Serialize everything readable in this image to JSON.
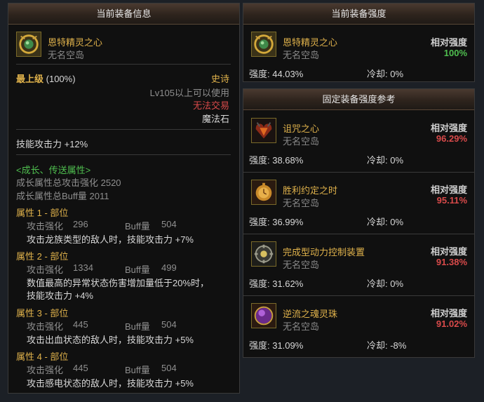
{
  "left_panel": {
    "header": "当前装备信息",
    "item": {
      "name": "恩特精灵之心",
      "source": "无名空岛",
      "icon": "green-gem-necklace-icon"
    },
    "grade_label": "最上级",
    "grade_pct": "(100%)",
    "rarity": "史诗",
    "level_req": "Lv105以上可以使用",
    "trade": "无法交易",
    "type": "魔法石",
    "main_stat": "技能攻击力 +12%",
    "growth": {
      "title": "<成长、传送属性>",
      "total_attack": "成长属性总攻击强化 2520",
      "total_buff": "成长属性总Buff量 2011",
      "attrs": [
        {
          "title": "属性 1 - 部位",
          "attack_label": "攻击强化",
          "attack_val": "296",
          "buff_label": "Buff量",
          "buff_val": "504",
          "desc1": "攻击龙族类型的敌人时，技能攻击力 +7%",
          "desc2": ""
        },
        {
          "title": "属性 2 - 部位",
          "attack_label": "攻击强化",
          "attack_val": "1334",
          "buff_label": "Buff量",
          "buff_val": "499",
          "desc1": "数值最高的异常状态伤害增加量低于20%时，",
          "desc2": "技能攻击力 +4%"
        },
        {
          "title": "属性 3 - 部位",
          "attack_label": "攻击强化",
          "attack_val": "445",
          "buff_label": "Buff量",
          "buff_val": "504",
          "desc1": "攻击出血状态的敌人时，技能攻击力 +5%",
          "desc2": ""
        },
        {
          "title": "属性 4 - 部位",
          "attack_label": "攻击强化",
          "attack_val": "445",
          "buff_label": "Buff量",
          "buff_val": "504",
          "desc1": "攻击感电状态的敌人时，技能攻击力 +5%",
          "desc2": ""
        }
      ]
    }
  },
  "current_strength": {
    "header": "当前装备强度",
    "item": {
      "name": "恩特精灵之心",
      "source": "无名空岛",
      "icon": "green-gem-necklace-icon",
      "rel_label": "相对强度",
      "rel_value": "100%",
      "strength": "强度: 44.03%",
      "cooldown": "冷却: 0%"
    }
  },
  "reference": {
    "header": "固定装备强度参考",
    "items": [
      {
        "name": "诅咒之心",
        "source": "无名空岛",
        "icon": "cursed-heart-icon",
        "rel_label": "相对强度",
        "rel_value": "96.29%",
        "strength": "强度: 38.68%",
        "cooldown": "冷却: 0%"
      },
      {
        "name": "胜利约定之时",
        "source": "无名空岛",
        "icon": "golden-pocket-watch-icon",
        "rel_label": "相对强度",
        "rel_value": "95.11%",
        "strength": "强度: 36.99%",
        "cooldown": "冷却: 0%"
      },
      {
        "name": "完成型动力控制装置",
        "source": "无名空岛",
        "icon": "gear-device-icon",
        "rel_label": "相对强度",
        "rel_value": "91.38%",
        "strength": "强度: 31.62%",
        "cooldown": "冷却: 0%"
      },
      {
        "name": "逆流之魂灵珠",
        "source": "无名空岛",
        "icon": "purple-orb-icon",
        "rel_label": "相对强度",
        "rel_value": "91.02%",
        "strength": "强度: 31.09%",
        "cooldown": "冷却: -8%"
      }
    ]
  },
  "colors": {
    "rarity_gold": "#e0b24b",
    "positive_green": "#4fbf4f",
    "negative_red": "#d94a4a",
    "untradable_red": "#d94a4a",
    "growth_green": "#4fbf4f"
  }
}
